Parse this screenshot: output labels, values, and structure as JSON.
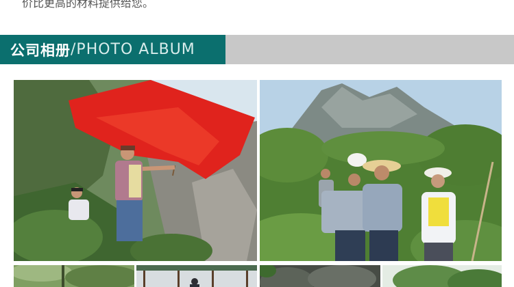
{
  "intro": {
    "text": "价比更高的材料提供给您。"
  },
  "album_header": {
    "title_cn": "公司相册",
    "separator": "/",
    "title_en": "PHOTO ALBUM",
    "accent_color": "#0b6f6e",
    "bar_color": "#c8c8c8"
  },
  "photos": [
    {
      "subject": "hiker waving red flag on mountain"
    },
    {
      "subject": "group of hikers in front of mountain peak"
    },
    {
      "subject": "forest trail"
    },
    {
      "subject": "pavilion"
    },
    {
      "subject": "rocks"
    },
    {
      "subject": "trees"
    }
  ]
}
